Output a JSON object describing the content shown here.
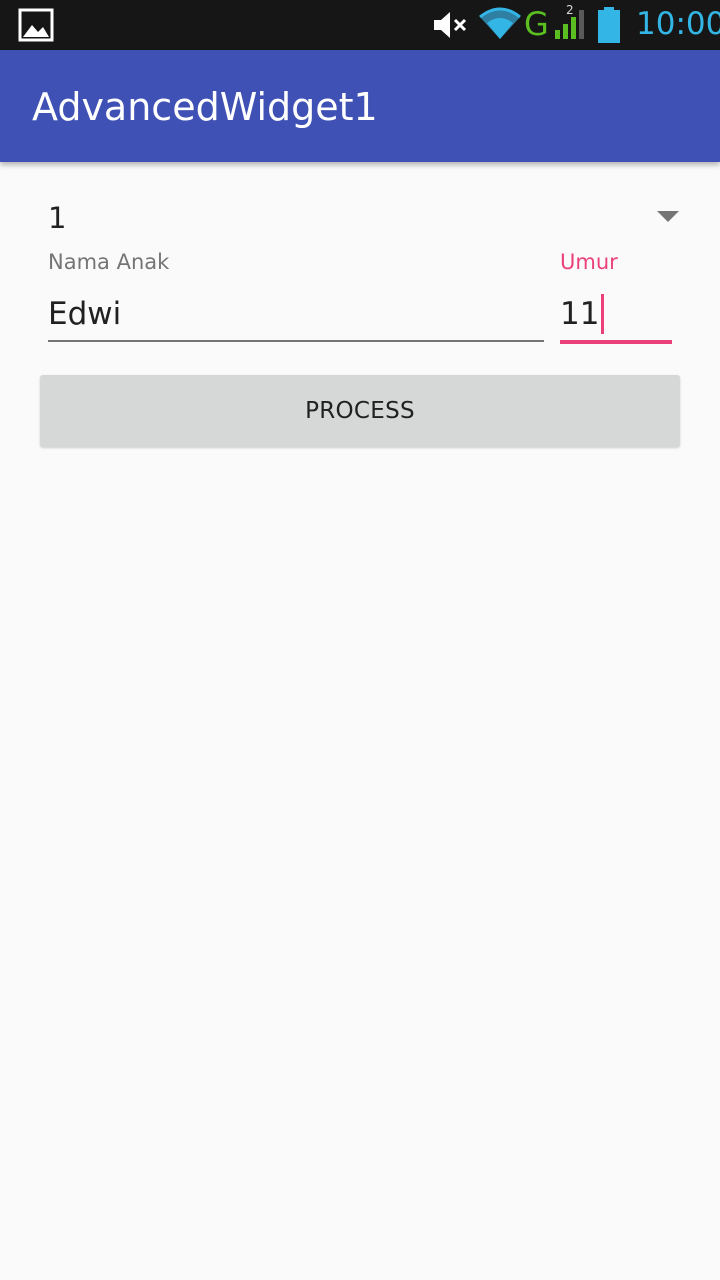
{
  "status_bar": {
    "network_type": "G",
    "sim_slot": "2",
    "time": "10:00",
    "icons": [
      "gallery-icon",
      "mute-icon",
      "wifi-icon",
      "signal-icon",
      "battery-icon"
    ]
  },
  "app_bar": {
    "title": "AdvancedWidget1",
    "color": "#3f51b5"
  },
  "form": {
    "spinner": {
      "selected": "1"
    },
    "nama_anak": {
      "label": "Nama Anak",
      "value": "Edwi"
    },
    "umur": {
      "label": "Umur",
      "value": "11",
      "focused": true
    },
    "process_button": {
      "label": "PROCESS"
    }
  },
  "colors": {
    "accent": "#ec407a",
    "primary": "#3f51b5",
    "status_time": "#33b5e5",
    "network": "#5bbf21"
  }
}
